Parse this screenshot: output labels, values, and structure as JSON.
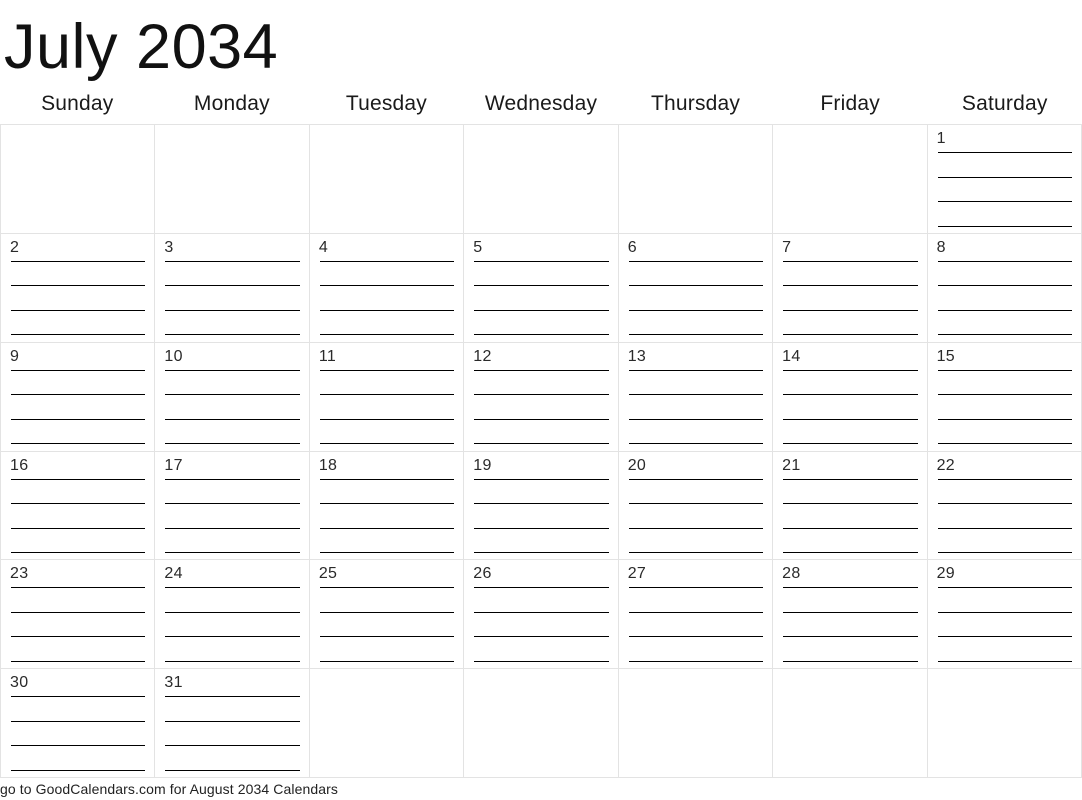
{
  "title": "July 2034",
  "month": "July",
  "year": "2034",
  "weekdays": [
    "Sunday",
    "Monday",
    "Tuesday",
    "Wednesday",
    "Thursday",
    "Friday",
    "Saturday"
  ],
  "grid": {
    "rows": 6,
    "columns": 7,
    "lines_per_day": 4,
    "cells": [
      "",
      "",
      "",
      "",
      "",
      "",
      "1",
      "2",
      "3",
      "4",
      "5",
      "6",
      "7",
      "8",
      "9",
      "10",
      "11",
      "12",
      "13",
      "14",
      "15",
      "16",
      "17",
      "18",
      "19",
      "20",
      "21",
      "22",
      "23",
      "24",
      "25",
      "26",
      "27",
      "28",
      "29",
      "30",
      "31",
      "",
      "",
      "",
      "",
      ""
    ]
  },
  "footer": {
    "text": "go to GoodCalendars.com for August 2034 Calendars"
  },
  "colors": {
    "grid_line": "#e3e3e3",
    "writing_line": "#000000",
    "text": "#1a1a1a",
    "background": "#ffffff"
  }
}
